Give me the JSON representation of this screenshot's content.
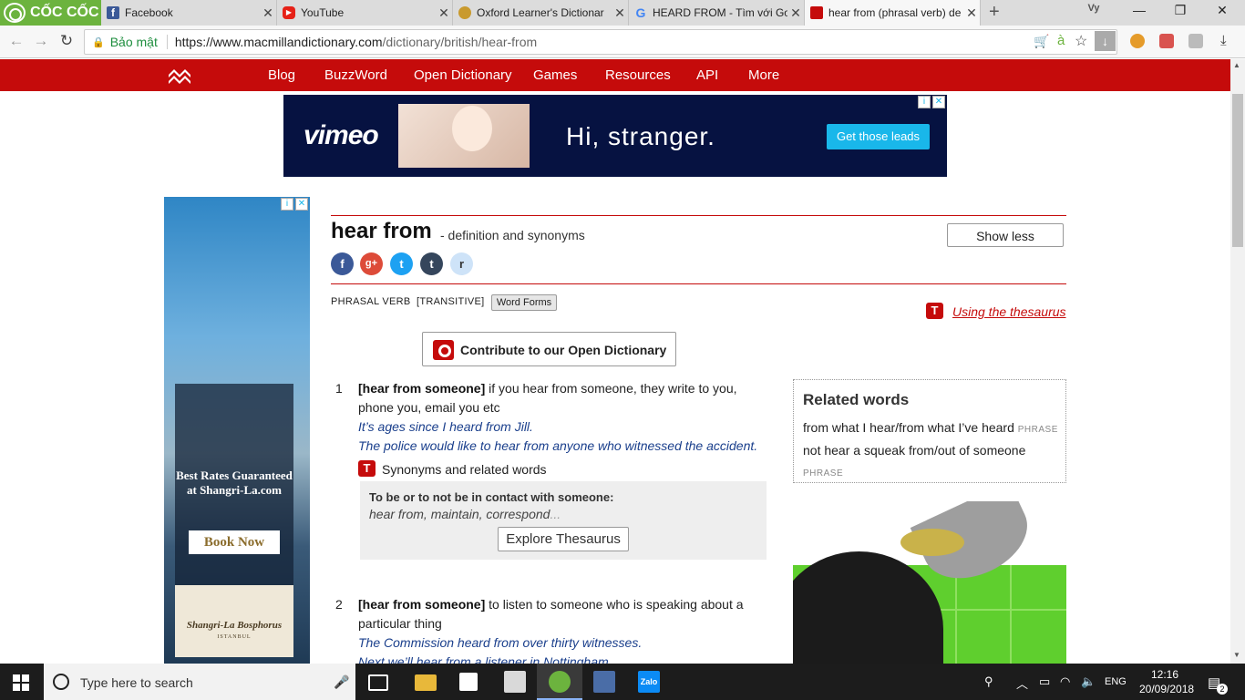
{
  "browser": {
    "brand": "CỐC CỐC",
    "tabs": [
      {
        "title": "Facebook",
        "color": "#3b5998"
      },
      {
        "title": "YouTube",
        "color": "#e62117"
      },
      {
        "title": "Oxford Learner's Dictionar",
        "color": "#c99a2e"
      },
      {
        "title": "HEARD FROM - Tìm với Go",
        "color": "#4285f4"
      },
      {
        "title": "hear from (phrasal verb) de",
        "color": "#c50b0b"
      }
    ],
    "user_badge": "Vy",
    "security_label": "Bảo mật",
    "url_host": "https://www.macmillandictionary.com",
    "url_path": "/dictionary/british/hear-from",
    "addr_ext_text": "à"
  },
  "site_nav": {
    "items": [
      "Blog",
      "BuzzWord",
      "Open Dictionary",
      "Games",
      "Resources",
      "API",
      "More"
    ],
    "brand_color": "#c50b0b"
  },
  "ads": {
    "top": {
      "brand": "vimeo",
      "tagline": "Hi, stranger.",
      "cta": "Get those leads",
      "adchoice": "i"
    },
    "side": {
      "headline": "Best Rates Guaranteed at Shangri-La.com",
      "cta": "Book Now",
      "logo_text": "Shangri-La Bosphorus",
      "city": "ISTANBUL",
      "adchoice": "i"
    }
  },
  "entry": {
    "headword": "hear from",
    "subtitle": "- definition and synonyms",
    "show_less": "Show less",
    "share_icons": [
      "f",
      "g+",
      "t",
      "t",
      "r"
    ],
    "part_of_speech": "PHRASAL VERB",
    "grammar": "[TRANSITIVE]",
    "word_forms": "Word Forms",
    "thesaurus_link": "Using the thesaurus",
    "thesaurus_icon": "T",
    "contribute": "Contribute to our Open Dictionary",
    "senses": [
      {
        "num": "1",
        "pattern": "[hear from someone]",
        "definition_line1": " if you hear from someone, they write to you,",
        "definition_line2": "phone you, email you etc",
        "examples": [
          "It’s ages since I heard from Jill.",
          "The police would like to hear from anyone who witnessed the accident."
        ]
      },
      {
        "num": "2",
        "pattern": "[hear from someone]",
        "definition_line1": " to listen to someone who is speaking about a",
        "definition_line2": "particular thing",
        "examples": [
          "The Commission heard from over thirty witnesses.",
          "Next we’ll hear from a listener in Nottingham."
        ]
      }
    ],
    "synonyms_label": "Synonyms and related words",
    "thesaurus_box": {
      "heading": "To be or to not be in contact with someone:",
      "words": "hear from, maintain, correspond",
      "ellipsis": "...",
      "button": "Explore Thesaurus"
    }
  },
  "related": {
    "heading": "Related words",
    "items": [
      {
        "text": "from what I hear/from what I’ve heard",
        "tag": "PHRASE"
      },
      {
        "text": "not hear a squeak from/out of someone",
        "tag": "PHRASE"
      }
    ]
  },
  "taskbar": {
    "search_placeholder": "Type here to search",
    "lang": "ENG",
    "time": "12:16",
    "date": "20/09/2018",
    "notifications": "2",
    "zalo": "Zalo"
  }
}
